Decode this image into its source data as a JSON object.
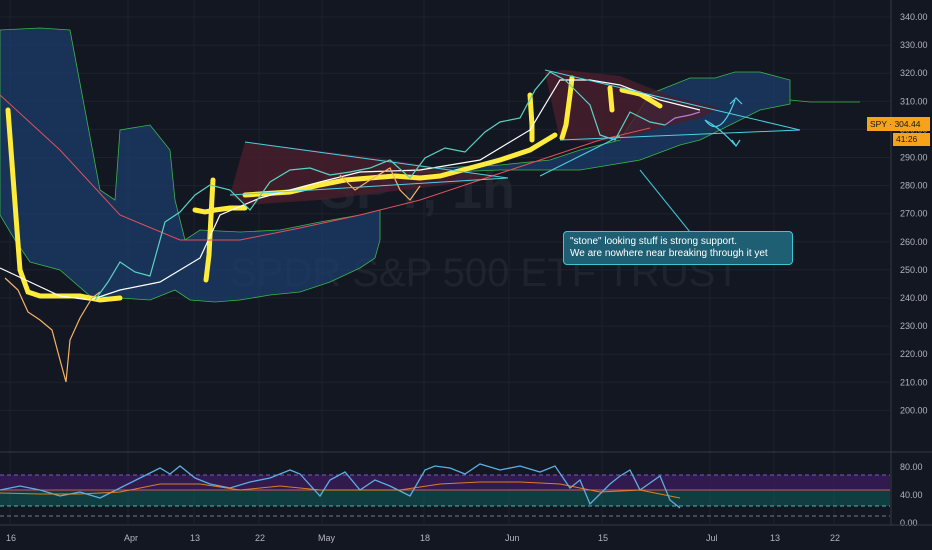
{
  "chart": {
    "watermark_ticker": "SPY, 1h",
    "watermark_name": "SPDR S&P 500 ETF TRUST",
    "price_axis_labels": [
      "340.00",
      "330.00",
      "320.00",
      "310.00",
      "300.00",
      "290.00",
      "280.00",
      "270.00",
      "260.00",
      "250.00",
      "240.00",
      "230.00",
      "220.00",
      "210.00",
      "200.00"
    ],
    "oscillator_axis_labels": [
      "80.00",
      "40.00",
      "0.00"
    ],
    "time_axis_labels": [
      "16",
      "Apr",
      "13",
      "22",
      "May",
      "18",
      "Jun",
      "15",
      "Jul",
      "13",
      "22"
    ],
    "last_price_symbol": "SPY",
    "last_price_value": "304.44",
    "bar_countdown": "41:26",
    "annotation_line1": "\"stone\" looking stuff is strong support.",
    "annotation_line2": "We are nowhere near breaking through it yet"
  },
  "colors": {
    "background": "#131722",
    "cloud": "#1b3c6b",
    "trend_ribbon": "#ffeb3b",
    "fan_fill": "#4a1e2c",
    "trendline": "#4dd0e1",
    "ma_red": "#e0505a",
    "price_tag": "#f7a21b"
  },
  "chart_data": {
    "type": "line",
    "symbol": "SPY",
    "ylim": [
      200,
      340
    ],
    "price_path": [
      {
        "x": "16",
        "y": 257
      },
      {
        "x": "Apr",
        "y": 249
      },
      {
        "x": "13",
        "y": 278
      },
      {
        "x": "22",
        "y": 280
      },
      {
        "x": "May",
        "y": 285
      },
      {
        "x": "18",
        "y": 292
      },
      {
        "x": "Jun",
        "y": 302
      },
      {
        "x": "15",
        "y": 300
      },
      {
        "x": "Jul",
        "y": 304.44
      }
    ],
    "oscillator_ylim": [
      0,
      90
    ]
  }
}
